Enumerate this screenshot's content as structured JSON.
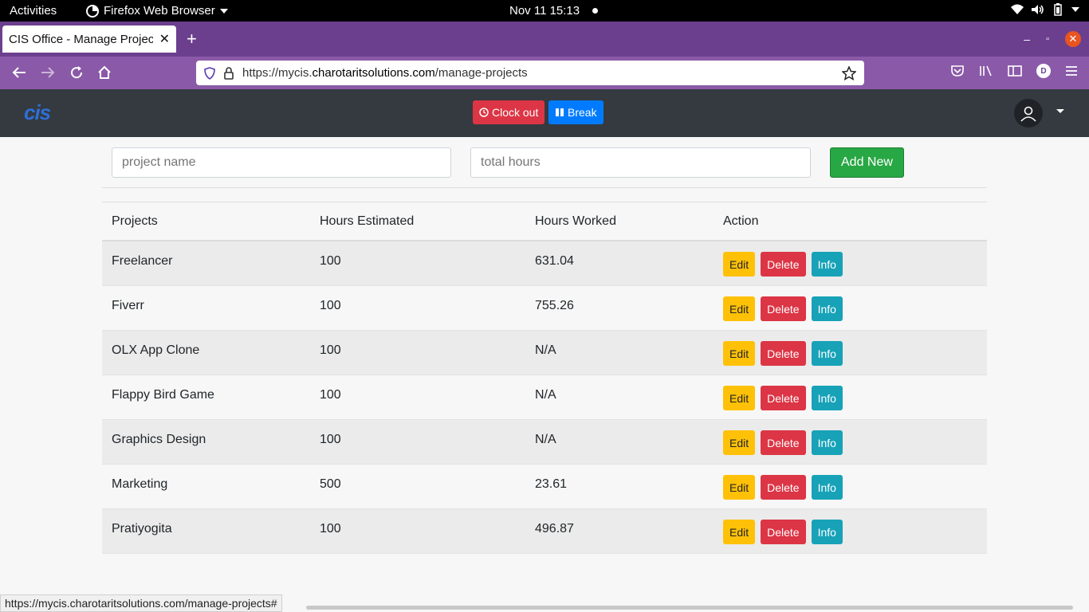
{
  "gnome": {
    "activities": "Activities",
    "app_name": "Firefox Web Browser",
    "clock": "Nov 11  15:13"
  },
  "browser": {
    "tab_title": "CIS Office - Manage Projects",
    "url_prefix": "https://mycis.",
    "url_host": "charotaritsolutions.com",
    "url_path": "/manage-projects",
    "status_url": "https://mycis.charotaritsolutions.com/manage-projects#",
    "profile_initial": "D"
  },
  "app": {
    "logo_text": "cis",
    "clock_out_label": "Clock out",
    "break_label": "Break"
  },
  "form": {
    "project_name_placeholder": "project name",
    "total_hours_placeholder": "total hours",
    "add_new_label": "Add New"
  },
  "table": {
    "headers": [
      "Projects",
      "Hours Estimated",
      "Hours Worked",
      "Action"
    ],
    "action_labels": {
      "edit": "Edit",
      "delete": "Delete",
      "info": "Info"
    },
    "rows": [
      {
        "project": "Freelancer",
        "estimated": "100",
        "worked": "631.04"
      },
      {
        "project": "Fiverr",
        "estimated": "100",
        "worked": "755.26"
      },
      {
        "project": "OLX App Clone",
        "estimated": "100",
        "worked": "N/A"
      },
      {
        "project": "Flappy Bird Game",
        "estimated": "100",
        "worked": "N/A"
      },
      {
        "project": "Graphics Design",
        "estimated": "100",
        "worked": "N/A"
      },
      {
        "project": "Marketing",
        "estimated": "500",
        "worked": "23.61"
      },
      {
        "project": "Pratiyogita",
        "estimated": "100",
        "worked": "496.87"
      }
    ]
  },
  "colors": {
    "tab_strip": "#6c3f8e",
    "toolbar": "#8a5aa8",
    "app_nav": "#343a40",
    "danger": "#dc3545",
    "primary": "#007bff",
    "success": "#28a745",
    "warning": "#ffc107",
    "info": "#17a2b8"
  }
}
